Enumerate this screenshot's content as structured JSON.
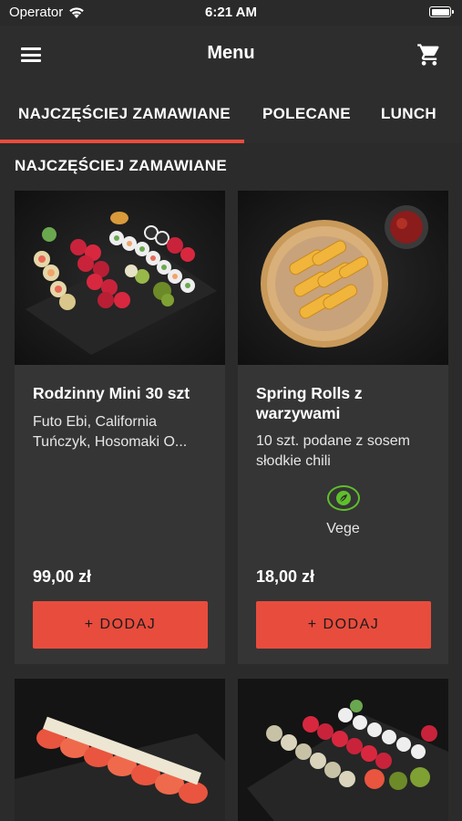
{
  "status_bar": {
    "carrier": "Operator",
    "time": "6:21 AM"
  },
  "app_bar": {
    "title": "Menu",
    "menu_icon": "hamburger-menu-icon",
    "cart_icon": "cart-icon"
  },
  "tabs": [
    {
      "label": "NAJCZĘŚCIEJ ZAMAWIANE",
      "active": true
    },
    {
      "label": "POLECANE",
      "active": false
    },
    {
      "label": "LUNCH",
      "active": false
    }
  ],
  "accent_color": "#e84c3d",
  "section_title": "NAJCZĘŚCIEJ ZAMAWIANE",
  "products": [
    {
      "name": "Rodzinny Mini 30 szt",
      "description_line1": "Futo Ebi, California",
      "description_line2": "Tuńczyk, Hosomaki O...",
      "price": "99,00 zł",
      "button_label": "+ DODAJ"
    },
    {
      "name": "Spring Rolls z warzywami",
      "description": "10 szt. podane z sosem słodkie chili",
      "badge": "Vege",
      "badge_icon": "leaf-icon",
      "price": "18,00 zł",
      "button_label": "+ DODAJ"
    }
  ]
}
